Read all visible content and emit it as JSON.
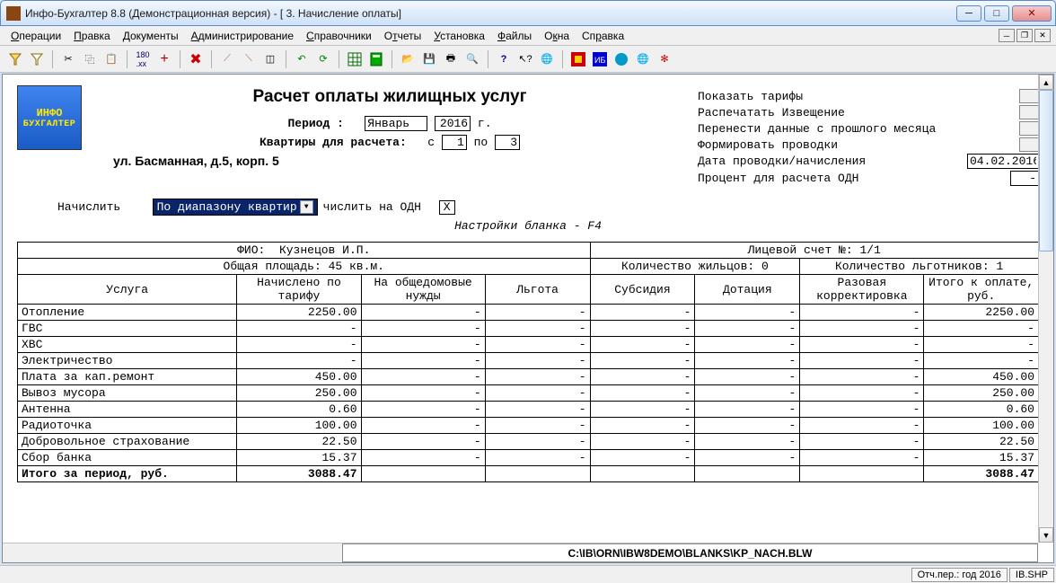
{
  "window": {
    "title": "Инфо-Бухгалтер 8.8 (Демонстрационная версия) - [   3. Начисление оплаты]"
  },
  "menu": {
    "items": [
      "Операции",
      "Правка",
      "Документы",
      "Администрирование",
      "Справочники",
      "Отчеты",
      "Установка",
      "Файлы",
      "Окна",
      "Справка"
    ]
  },
  "doc": {
    "title": "Расчет оплаты жилищных услуг",
    "period_label": "Период :",
    "month": "Январь",
    "year": "2016",
    "year_suffix": "г.",
    "apartments_label": "Квартиры для расчета:",
    "from_label": "с",
    "from": "1",
    "to_label": "по",
    "to": "3",
    "address": "ул. Басманная, д.5, корп. 5",
    "calc_label": "Начислить",
    "calc_mode": "По диапазону квартир",
    "calc_suffix": "числить на ОДН",
    "checkbox": "X",
    "hint": "Настройки бланка - F4"
  },
  "side": {
    "r1": "Показать тарифы",
    "r2": "Распечатать Извещение",
    "r3": "Перенести данные с прошлого месяца",
    "r4": "Формировать проводки",
    "r5": "Дата проводки/начисления",
    "r5_val": "04.02.2016",
    "r6": "Процент для расчета ОДН",
    "r6_val": "-"
  },
  "table": {
    "fio_label": "ФИО:",
    "fio": "Кузнецов И.П.",
    "account_label": "Лицевой счет №:",
    "account": "1/1",
    "area_label": "Общая площадь:",
    "area": "45 кв.м.",
    "residents_label": "Количество жильцов:",
    "residents": "0",
    "benefit_label": "Количество льготников:",
    "benefit": "1",
    "cols": [
      "Услуга",
      "Начислено по тарифу",
      "На общедомовые нужды",
      "Льгота",
      "Субсидия",
      "Дотация",
      "Разовая корректировка",
      "Итого к оплате, руб."
    ],
    "rows": [
      {
        "name": "Отопление",
        "tariff": "2250.00",
        "odn": "-",
        "lgota": "-",
        "sub": "-",
        "dot": "-",
        "corr": "-",
        "total": "2250.00"
      },
      {
        "name": "ГВС",
        "tariff": "-",
        "odn": "-",
        "lgota": "-",
        "sub": "-",
        "dot": "-",
        "corr": "-",
        "total": "-"
      },
      {
        "name": "ХВС",
        "tariff": "-",
        "odn": "-",
        "lgota": "-",
        "sub": "-",
        "dot": "-",
        "corr": "-",
        "total": "-"
      },
      {
        "name": "Электричество",
        "tariff": "-",
        "odn": "-",
        "lgota": "-",
        "sub": "-",
        "dot": "-",
        "corr": "-",
        "total": "-"
      },
      {
        "name": "Плата за кап.ремонт",
        "tariff": "450.00",
        "odn": "-",
        "lgota": "-",
        "sub": "-",
        "dot": "-",
        "corr": "-",
        "total": "450.00"
      },
      {
        "name": "Вывоз мусора",
        "tariff": "250.00",
        "odn": "-",
        "lgota": "-",
        "sub": "-",
        "dot": "-",
        "corr": "-",
        "total": "250.00"
      },
      {
        "name": "Антенна",
        "tariff": "0.60",
        "odn": "-",
        "lgota": "-",
        "sub": "-",
        "dot": "-",
        "corr": "-",
        "total": "0.60"
      },
      {
        "name": "Радиоточка",
        "tariff": "100.00",
        "odn": "-",
        "lgota": "-",
        "sub": "-",
        "dot": "-",
        "corr": "-",
        "total": "100.00"
      },
      {
        "name": "Добровольное страхование",
        "tariff": "22.50",
        "odn": "-",
        "lgota": "-",
        "sub": "-",
        "dot": "-",
        "corr": "-",
        "total": "22.50"
      },
      {
        "name": "Сбор банка",
        "tariff": "15.37",
        "odn": "-",
        "lgota": "-",
        "sub": "-",
        "dot": "-",
        "corr": "-",
        "total": "15.37"
      }
    ],
    "total_label": "Итого за период, руб.",
    "total_tariff": "3088.47",
    "total_total": "3088.47"
  },
  "logo": {
    "l1": "ИНФО",
    "l2": "БУХГАЛТЕР"
  },
  "path": "C:\\IB\\ORN\\IBW8DEMO\\BLANKS\\KP_NACH.BLW",
  "status": {
    "period": "Отч.пер.: год 2016",
    "file": "IB.SHP"
  }
}
